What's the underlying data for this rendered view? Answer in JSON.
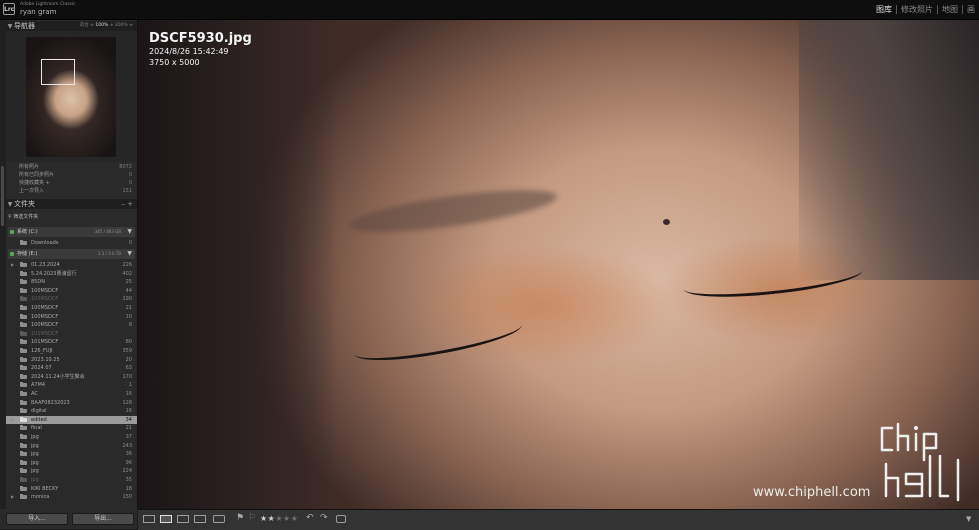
{
  "topbar": {
    "app_name": "Adobe Lightroom Classic",
    "user_name": "ryan gram",
    "logo_text": "Lrc",
    "modules": [
      "图库",
      "修改照片",
      "地图",
      "画"
    ]
  },
  "navigator": {
    "title": "导航器",
    "zoom_options": [
      "适合",
      "100%",
      "200%"
    ],
    "zoom_selected": "100%"
  },
  "catalog": {
    "items": [
      {
        "label": "所有照片",
        "count": "8072"
      },
      {
        "label": "所有已同步照片",
        "count": "0"
      },
      {
        "label": "快捷收藏夹 +",
        "count": "0"
      },
      {
        "label": "上一次导入",
        "count": "151"
      }
    ]
  },
  "folders": {
    "title": "文件夹",
    "header_actions": "– +",
    "filter_label": "筛选文件夹",
    "volumes": [
      {
        "label": "系统 (C:)",
        "space": "345 / 463 GB",
        "menu": "▼"
      },
      {
        "label": "存储 (E:)",
        "space": "3.3 / 3.6 TB",
        "menu": "▼"
      }
    ],
    "system_children": [
      {
        "label": "Downloads",
        "count": "0"
      }
    ],
    "items": [
      {
        "label": "01.23.2024",
        "count": "226"
      },
      {
        "label": "5.24.2023曹浦留行",
        "count": "402"
      },
      {
        "label": "85DN",
        "count": "25"
      },
      {
        "label": "100MSDCF",
        "count": "44"
      },
      {
        "label": "100MSDCF",
        "count": "190",
        "dim": true
      },
      {
        "label": "100MSDCF",
        "count": "21"
      },
      {
        "label": "100MSDCF",
        "count": "10"
      },
      {
        "label": "100MSDCF",
        "count": "8"
      },
      {
        "label": "101MSDCF",
        "count": "",
        "dim": true
      },
      {
        "label": "101MSDCF",
        "count": "80"
      },
      {
        "label": "126_FUJI",
        "count": "359"
      },
      {
        "label": "2023.10.25",
        "count": "20"
      },
      {
        "label": "2024.07",
        "count": "63"
      },
      {
        "label": "2024.11.24小学生聚会",
        "count": "170"
      },
      {
        "label": "A7M4",
        "count": "1"
      },
      {
        "label": "AC",
        "count": "16"
      },
      {
        "label": "BAAF08232023",
        "count": "128"
      },
      {
        "label": "digital",
        "count": "16"
      },
      {
        "label": "edited",
        "count": "34",
        "selected": true
      },
      {
        "label": "final",
        "count": "21"
      },
      {
        "label": "jpg",
        "count": "37"
      },
      {
        "label": "jpg",
        "count": "243"
      },
      {
        "label": "jpg",
        "count": "36"
      },
      {
        "label": "jpg",
        "count": "96"
      },
      {
        "label": "jpg",
        "count": "224"
      },
      {
        "label": "jpg",
        "count": "35",
        "dim": true
      },
      {
        "label": "KIKI BECKY",
        "count": "18"
      },
      {
        "label": "monica",
        "count": "150"
      }
    ]
  },
  "bottom_buttons": {
    "import": "导入...",
    "export": "导出..."
  },
  "photo": {
    "filename": "DSCF5930.jpg",
    "datetime": "2024/8/26 15:42:49",
    "dimensions": "3750 x 5000"
  },
  "watermark": {
    "text": "www.chiphell.com"
  },
  "toolbar": {
    "rating_filled": "★★",
    "rating_empty": "★★★",
    "rating": 2
  }
}
